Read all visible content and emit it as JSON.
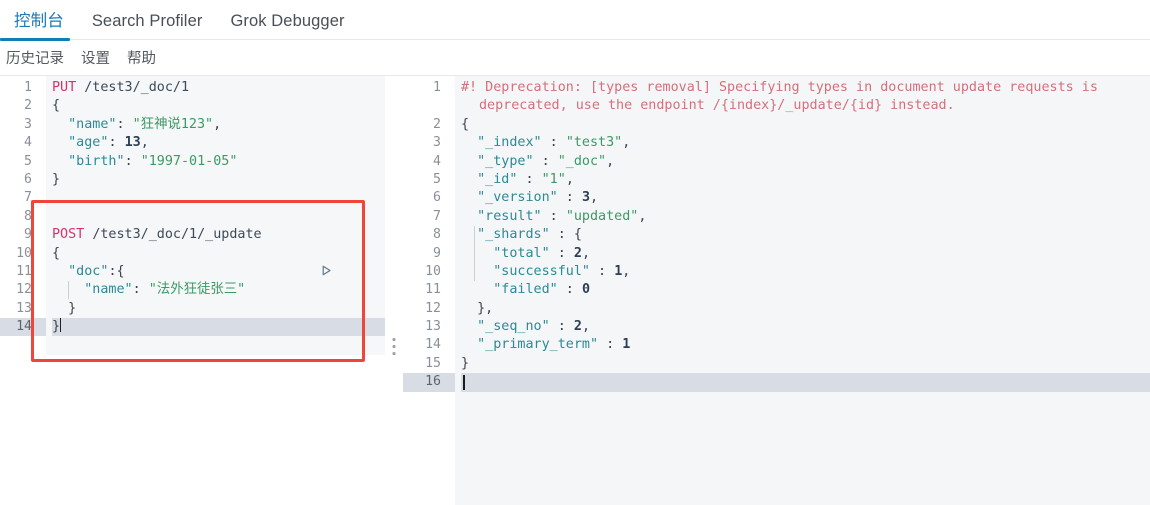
{
  "tabs": [
    {
      "label": "控制台",
      "active": true
    },
    {
      "label": "Search Profiler",
      "active": false
    },
    {
      "label": "Grok Debugger",
      "active": false
    }
  ],
  "links": [
    {
      "label": "历史记录"
    },
    {
      "label": "设置"
    },
    {
      "label": "帮助"
    }
  ],
  "colors": {
    "accent": "#0f7fb5",
    "active_tab_text": "#1a7ab8",
    "annotation": "#f0453a",
    "method": "#d6336c",
    "json_key": "#2c8a96",
    "json_string": "#3c9a64",
    "json_number": "#2d3f52",
    "warning": "#d4707b",
    "editor_bg": "#f6f7f9",
    "active_line": "#d8dde5"
  },
  "icons": {
    "play": "play-icon",
    "wrench": "wrench-icon",
    "splitter": "drag-handle-icon"
  },
  "request_editor": {
    "name": "request-editor",
    "line_count": 14,
    "active_line": 14,
    "fold_lines": [
      2,
      6,
      10,
      11,
      13,
      14
    ],
    "line_numbers": [
      "1",
      "2",
      "3",
      "4",
      "5",
      "6",
      "7",
      "8",
      "9",
      "10",
      "11",
      "12",
      "13",
      "14"
    ],
    "lines": [
      {
        "n": 1,
        "text": "PUT /test3/_doc/1"
      },
      {
        "n": 2,
        "text": "{"
      },
      {
        "n": 3,
        "text": "  \"name\": \"狂神说123\","
      },
      {
        "n": 4,
        "text": "  \"age\": 13,"
      },
      {
        "n": 5,
        "text": "  \"birth\": \"1997-01-05\""
      },
      {
        "n": 6,
        "text": "}"
      },
      {
        "n": 7,
        "text": ""
      },
      {
        "n": 8,
        "text": ""
      },
      {
        "n": 9,
        "text": "POST /test3/_doc/1/_update"
      },
      {
        "n": 10,
        "text": "{"
      },
      {
        "n": 11,
        "text": "  \"doc\":{"
      },
      {
        "n": 12,
        "text": "    \"name\": \"法外狂徒张三\""
      },
      {
        "n": 13,
        "text": "  }"
      },
      {
        "n": 14,
        "text": "}"
      }
    ],
    "request_1": {
      "method": "PUT",
      "url": "/test3/_doc/1",
      "body_keys": [
        "\"name\"",
        "\"age\"",
        "\"birth\""
      ],
      "body_values": [
        "\"狂神说123\"",
        "13",
        "\"1997-01-05\""
      ]
    },
    "request_2": {
      "method": "POST",
      "url": "/test3/_doc/1/_update",
      "body_key_outer": "\"doc\"",
      "body_key_inner": "\"name\"",
      "body_value_inner": "\"法外狂徒张三\""
    }
  },
  "response_editor": {
    "name": "response-viewer",
    "line_count": 16,
    "active_line": 16,
    "fold_lines": [
      2,
      8,
      12,
      15
    ],
    "line_numbers": [
      "1",
      "2",
      "3",
      "4",
      "5",
      "6",
      "7",
      "8",
      "9",
      "10",
      "11",
      "12",
      "13",
      "14",
      "15",
      "16"
    ],
    "warning_line_1": "#! Deprecation: [types removal] Specifying types in document update requests is",
    "warning_line_2": "deprecated, use the endpoint /{index}/_update/{id} instead.",
    "json": {
      "_index": "\"test3\"",
      "_type": "\"_doc\"",
      "_id": "\"1\"",
      "_version": "3",
      "result": "\"updated\"",
      "_shards": {
        "total": "2",
        "successful": "1",
        "failed": "0"
      },
      "_seq_no": "2",
      "_primary_term": "1"
    },
    "keys": {
      "k_index": "\"_index\"",
      "k_type": "\"_type\"",
      "k_id": "\"_id\"",
      "k_version": "\"_version\"",
      "k_result": "\"result\"",
      "k_shards": "\"_shards\"",
      "k_total": "\"total\"",
      "k_successful": "\"successful\"",
      "k_failed": "\"failed\"",
      "k_seq_no": "\"_seq_no\"",
      "k_primary_term": "\"_primary_term\""
    }
  },
  "annotation": {
    "name": "red-highlight-box",
    "target": "second-request-post-update"
  }
}
